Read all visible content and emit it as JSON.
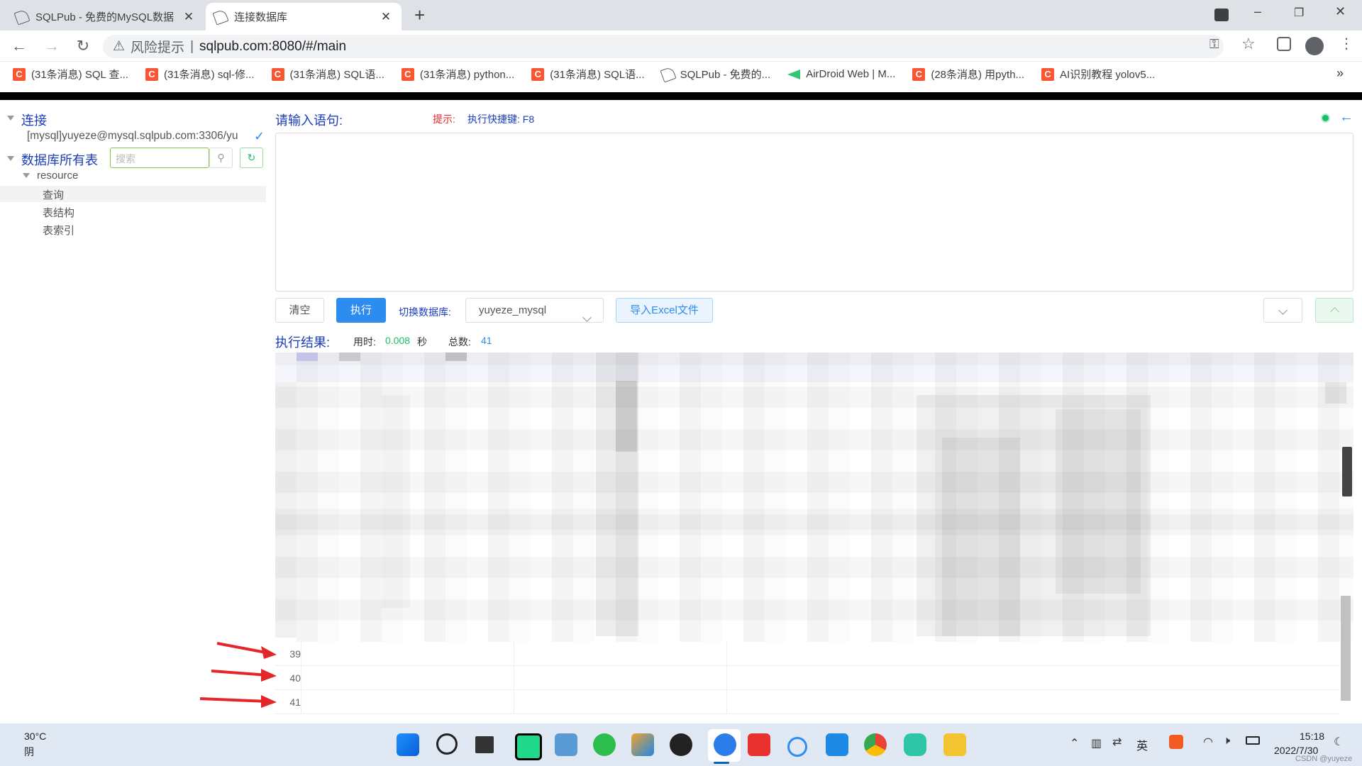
{
  "browser": {
    "tabs": [
      {
        "title": "SQLPub - 免费的MySQL数据",
        "active": false
      },
      {
        "title": "连接数据库",
        "active": true
      }
    ],
    "new_tab": "+",
    "window_controls": {
      "minimize": "–",
      "restore": "❐",
      "close": "✕"
    },
    "address": {
      "warning": "风险提示",
      "separator": "|",
      "url": "sqlpub.com:8080/#/main"
    },
    "bookmarks": [
      {
        "icon": "csdn-icon",
        "label": "(31条消息) SQL 查..."
      },
      {
        "icon": "csdn-icon",
        "label": "(31条消息) sql-修..."
      },
      {
        "icon": "csdn-icon",
        "label": "(31条消息) SQL语..."
      },
      {
        "icon": "csdn-icon",
        "label": "(31条消息) python..."
      },
      {
        "icon": "csdn-icon",
        "label": "(31条消息) SQL语..."
      },
      {
        "icon": "sqlpub-icon",
        "label": "SQLPub - 免费的..."
      },
      {
        "icon": "airdroid-icon",
        "label": "AirDroid Web | M..."
      },
      {
        "icon": "csdn-icon",
        "label": "(28条消息) 用pyth..."
      },
      {
        "icon": "csdn-icon",
        "label": "AI识别教程 yolov5..."
      }
    ],
    "bookmarks_more": "»"
  },
  "sidebar": {
    "connection_title": "连接",
    "connection_string": "[mysql]yuyeze@mysql.sqlpub.com:3306/yu",
    "tables_title": "数据库所有表",
    "search_placeholder": "搜索",
    "tree": {
      "node": "resource",
      "children": [
        "查询",
        "表结构",
        "表索引"
      ]
    }
  },
  "editor": {
    "label": "请输入语句:",
    "hint_label": "提示:",
    "hint_text": "执行快捷键: F8"
  },
  "toolbar": {
    "clear": "清空",
    "execute": "执行",
    "switch_db_label": "切换数据库:",
    "db_value": "yuyeze_mysql",
    "import_excel": "导入Excel文件"
  },
  "results": {
    "label": "执行结果:",
    "time_label": "用时:",
    "time_value": "0.008",
    "time_unit": "秒",
    "count_label": "总数:",
    "count_value": "41",
    "visible_rows": [
      "39",
      "40",
      "41"
    ]
  },
  "taskbar": {
    "weather_temp": "30°C",
    "weather_desc": "阴",
    "time": "15:18",
    "date": "2022/7/30",
    "ime": "英",
    "watermark": "CSDN @yuyeze"
  },
  "colors": {
    "accent": "#2d8cf0",
    "title_blue": "#1a3dbb",
    "hint_red": "#e4262a",
    "green": "#19be6b",
    "arrow_red": "#e3262a"
  }
}
